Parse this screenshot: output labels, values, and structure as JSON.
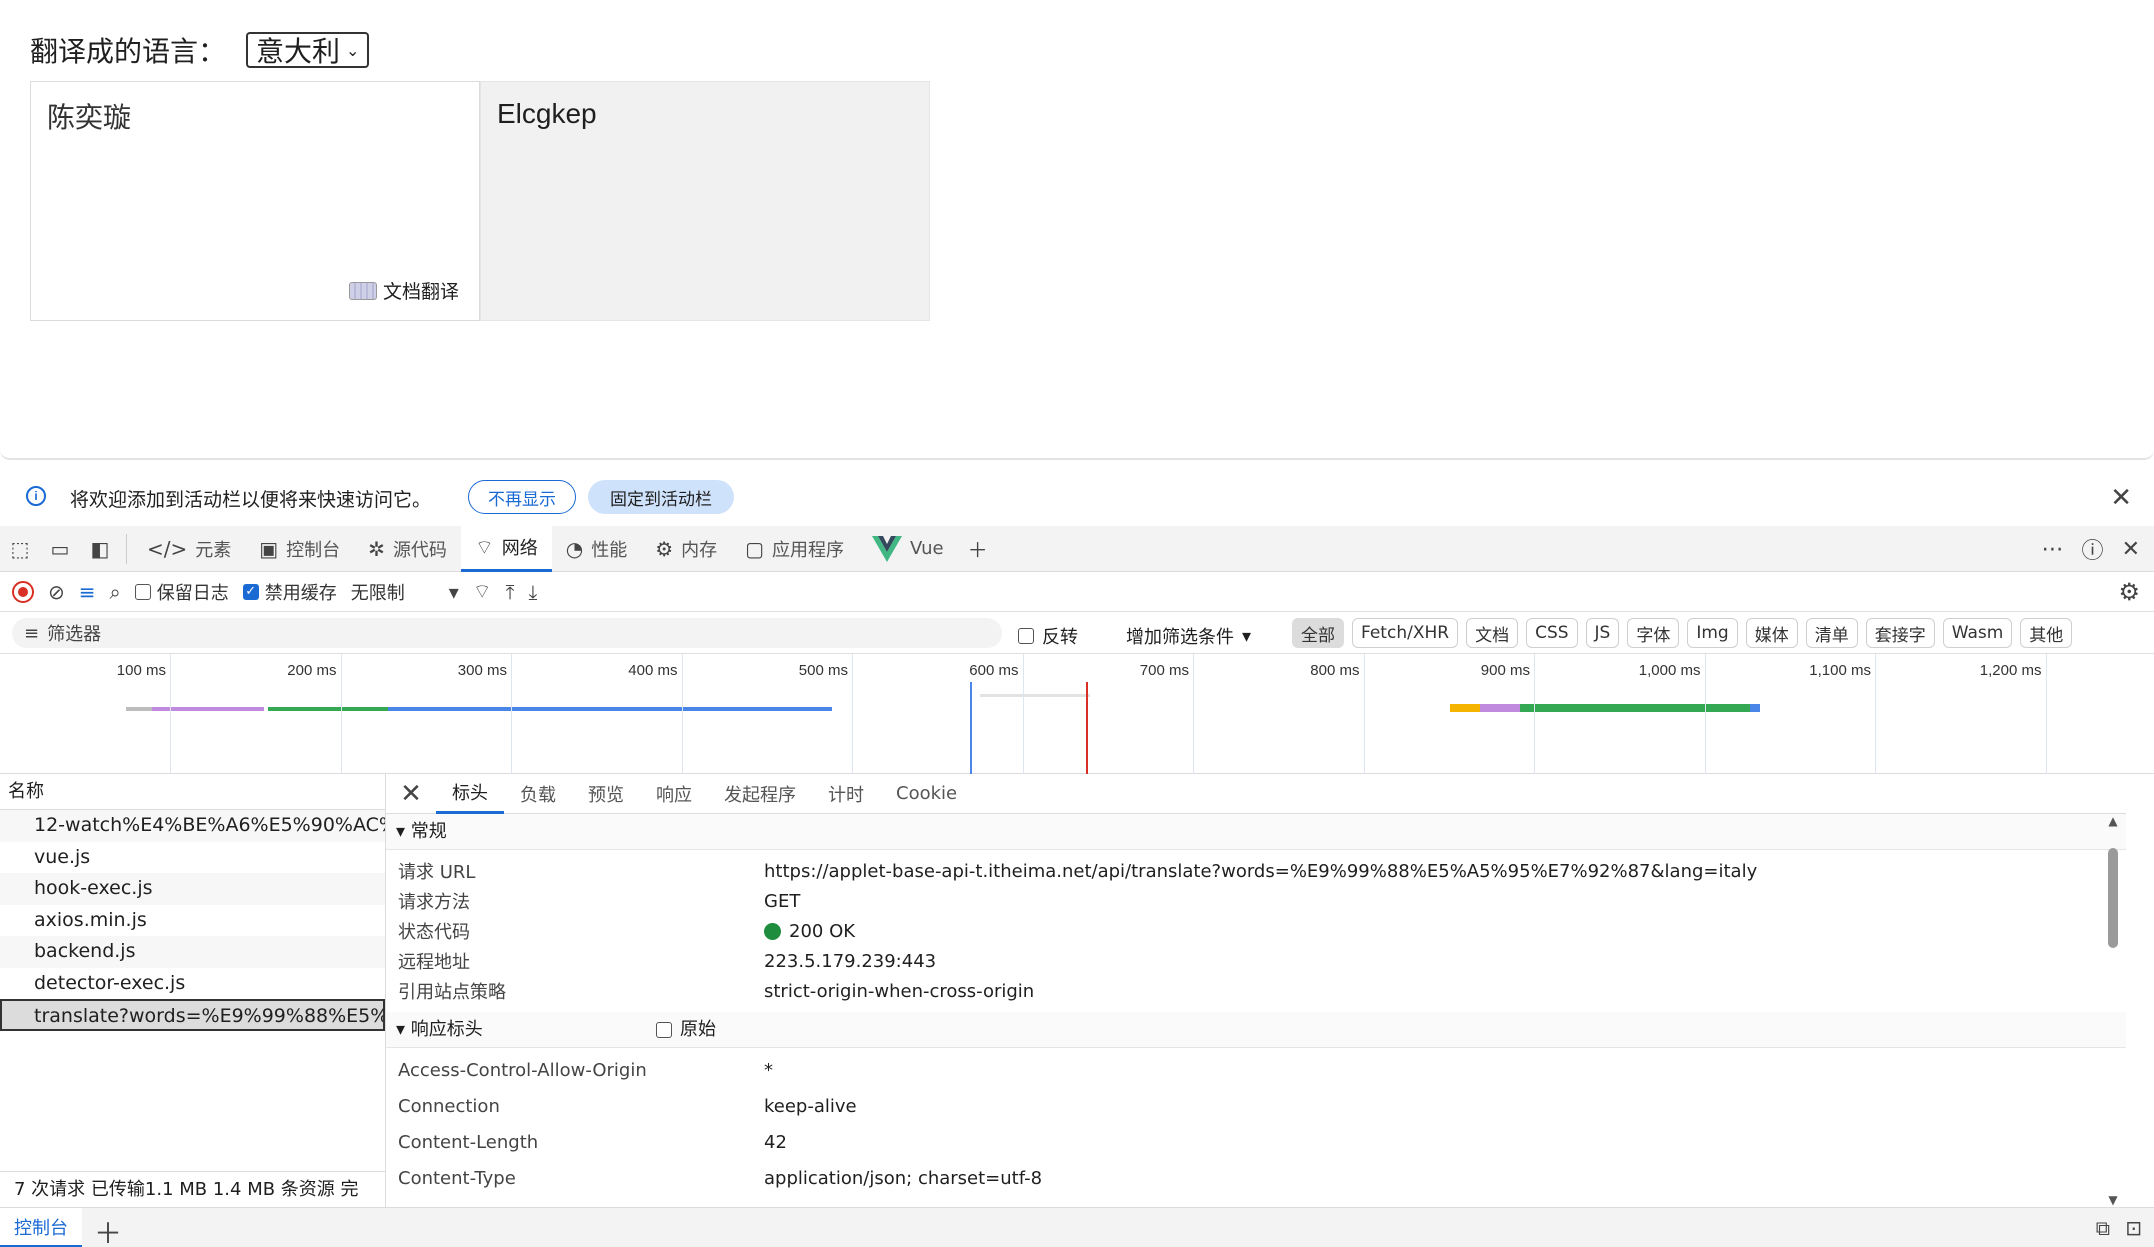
{
  "page": {
    "lang_label": "翻译成的语言：",
    "lang_selected": "意大利",
    "source_text": "陈奕璇",
    "doc_translate": "文档翻译",
    "output_text": "Elcgkep"
  },
  "notice": {
    "text": "将欢迎添加到活动栏以便将来快速访问它。",
    "dismiss": "不再显示",
    "pin": "固定到活动栏"
  },
  "devtools": {
    "tabs": [
      "元素",
      "控制台",
      "源代码",
      "网络",
      "性能",
      "内存",
      "应用程序",
      "Vue"
    ],
    "toolbar": {
      "preserve_log": "保留日志",
      "disable_cache": "禁用缓存",
      "throttle": "无限制"
    },
    "filter": {
      "placeholder": "筛选器",
      "invert": "反转",
      "add_filter": "增加筛选条件",
      "types": [
        "全部",
        "Fetch/XHR",
        "文档",
        "CSS",
        "JS",
        "字体",
        "Img",
        "媒体",
        "清单",
        "套接字",
        "Wasm",
        "其他"
      ]
    },
    "timeline_ticks": [
      "100 ms",
      "200 ms",
      "300 ms",
      "400 ms",
      "500 ms",
      "600 ms",
      "700 ms",
      "800 ms",
      "900 ms",
      "1,000 ms",
      "1,100 ms",
      "1,200 ms"
    ],
    "list_header": "名称",
    "requests": [
      "12-watch%E4%BE%A6%E5%90%AC%...",
      "vue.js",
      "hook-exec.js",
      "axios.min.js",
      "backend.js",
      "detector-exec.js",
      "translate?words=%E9%99%88%E5%A..."
    ],
    "status_bar": "7 次请求   已传输1.1 MB   1.4 MB 条资源   完",
    "detail_tabs": [
      "标头",
      "负载",
      "预览",
      "响应",
      "发起程序",
      "计时",
      "Cookie"
    ],
    "general": {
      "title": "▾ 常规",
      "rows": [
        {
          "k": "请求 URL",
          "v": "https://applet-base-api-t.itheima.net/api/translate?words=%E9%99%88%E5%A5%95%E7%92%87&lang=italy"
        },
        {
          "k": "请求方法",
          "v": "GET"
        },
        {
          "k": "状态代码",
          "v": "200 OK"
        },
        {
          "k": "远程地址",
          "v": "223.5.179.239:443"
        },
        {
          "k": "引用站点策略",
          "v": "strict-origin-when-cross-origin"
        }
      ]
    },
    "response_headers": {
      "title": "▾ 响应标头",
      "raw": "原始",
      "rows": [
        {
          "k": "Access-Control-Allow-Origin",
          "v": "*"
        },
        {
          "k": "Connection",
          "v": "keep-alive"
        },
        {
          "k": "Content-Length",
          "v": "42"
        },
        {
          "k": "Content-Type",
          "v": "application/json; charset=utf-8"
        }
      ]
    },
    "drawer_tab": "控制台"
  }
}
